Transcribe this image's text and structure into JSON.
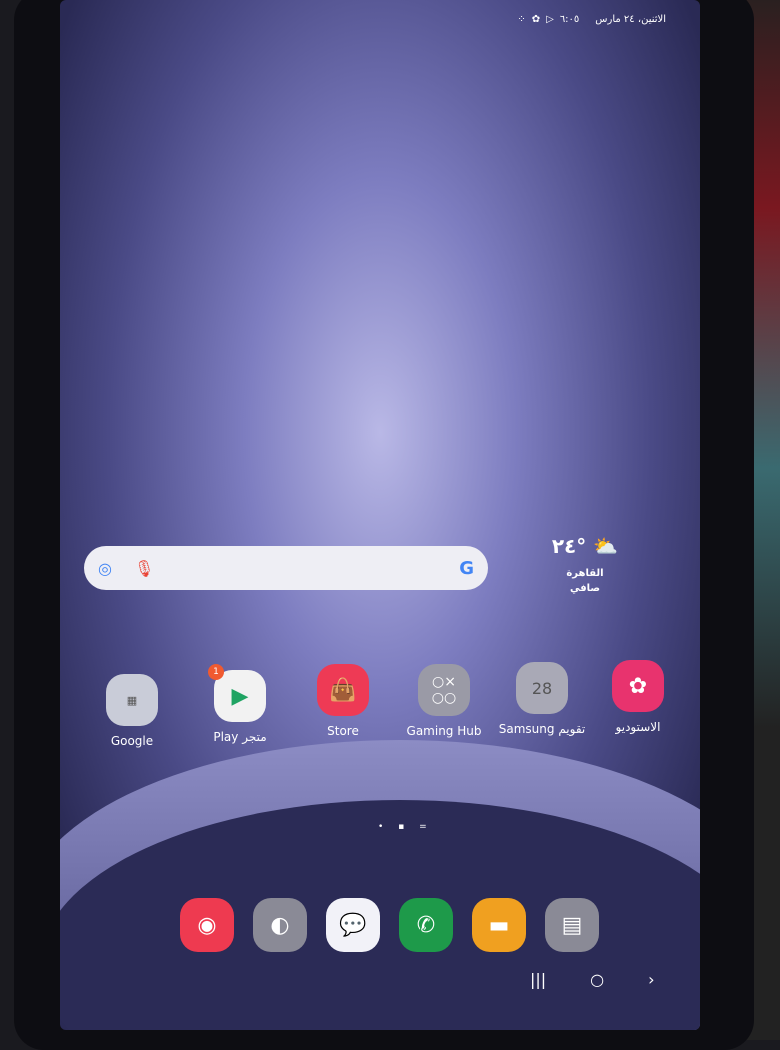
{
  "status_bar": {
    "datetime": "الاثنين، ٢٤ مارس",
    "time": "٦:٠٥",
    "icons": [
      "play-store-icon",
      "settings-icon",
      "apps-icon"
    ]
  },
  "search_bar": {
    "left_icon": "google-lens-icon",
    "mic_icon": "mic-icon",
    "logo": "G"
  },
  "weather": {
    "temperature": "٢٤°",
    "city": "القاهرة",
    "condition": "صافي",
    "icon": "partly-cloudy-icon"
  },
  "apps": [
    {
      "label": "Google",
      "icon": "folder-icon",
      "color": "#c9ccd8"
    },
    {
      "label": "Play متجر",
      "icon": "play-store-icon",
      "color": "#f2f2f2",
      "badge": "1"
    },
    {
      "label": "Store",
      "icon": "shopping-bag-icon",
      "color": "#ee3a55"
    },
    {
      "label": "Gaming Hub",
      "icon": "gaming-hub-icon",
      "color": "#9a9aa6"
    },
    {
      "label": "Samsung تقويم",
      "icon": "calendar-icon",
      "color": "#a9a9b6",
      "date": "28"
    },
    {
      "label": "الاستوديو",
      "icon": "gallery-icon",
      "color": "#e8336e"
    }
  ],
  "page_indicator": "• ▪ =",
  "dock": [
    {
      "icon": "camera-icon",
      "color": "#ee3a50",
      "glyph": "◉"
    },
    {
      "icon": "internet-icon",
      "color": "#8a8a96",
      "glyph": "◐"
    },
    {
      "icon": "messages-icon",
      "color": "#f2f2f8",
      "glyph": "💬"
    },
    {
      "icon": "phone-icon",
      "color": "#1e9a4a",
      "glyph": "✆"
    },
    {
      "icon": "my-files-icon",
      "color": "#f0a020",
      "glyph": "▬"
    },
    {
      "icon": "notes-icon",
      "color": "#8a8a96",
      "glyph": "▤"
    }
  ],
  "nav_bar": {
    "recents": "|||",
    "home": "○",
    "back": "›"
  }
}
